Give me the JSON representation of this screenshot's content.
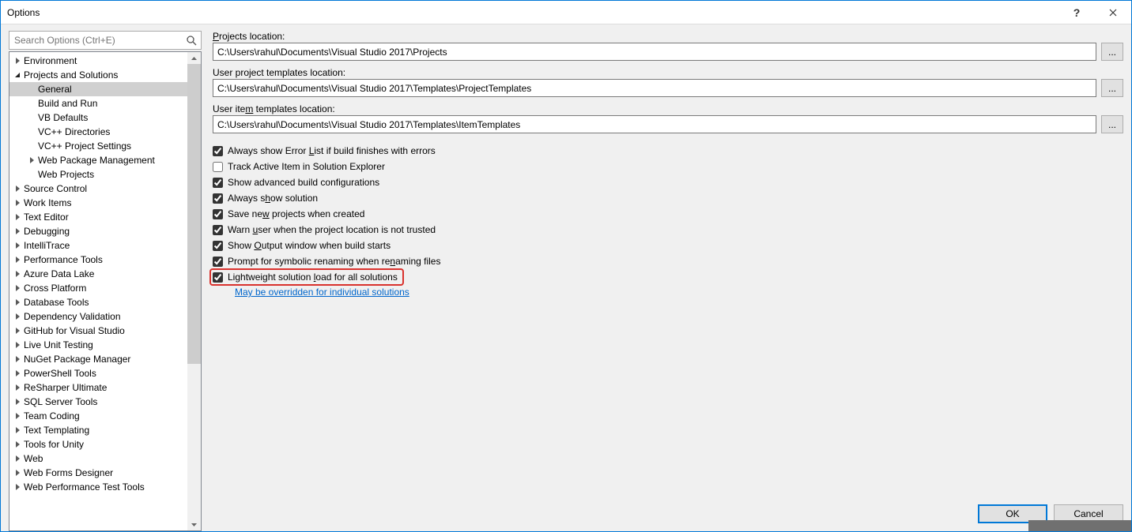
{
  "title": "Options",
  "search": {
    "placeholder": "Search Options (Ctrl+E)"
  },
  "tree": {
    "items": [
      {
        "label": "Environment",
        "indent": 0,
        "arrow": "closed"
      },
      {
        "label": "Projects and Solutions",
        "indent": 0,
        "arrow": "open"
      },
      {
        "label": "General",
        "indent": 1,
        "selected": true
      },
      {
        "label": "Build and Run",
        "indent": 1
      },
      {
        "label": "VB Defaults",
        "indent": 1
      },
      {
        "label": "VC++ Directories",
        "indent": 1
      },
      {
        "label": "VC++ Project Settings",
        "indent": 1
      },
      {
        "label": "Web Package Management",
        "indent": 1,
        "arrow": "closed"
      },
      {
        "label": "Web Projects",
        "indent": 1
      },
      {
        "label": "Source Control",
        "indent": 0,
        "arrow": "closed"
      },
      {
        "label": "Work Items",
        "indent": 0,
        "arrow": "closed"
      },
      {
        "label": "Text Editor",
        "indent": 0,
        "arrow": "closed"
      },
      {
        "label": "Debugging",
        "indent": 0,
        "arrow": "closed"
      },
      {
        "label": "IntelliTrace",
        "indent": 0,
        "arrow": "closed"
      },
      {
        "label": "Performance Tools",
        "indent": 0,
        "arrow": "closed"
      },
      {
        "label": "Azure Data Lake",
        "indent": 0,
        "arrow": "closed"
      },
      {
        "label": "Cross Platform",
        "indent": 0,
        "arrow": "closed"
      },
      {
        "label": "Database Tools",
        "indent": 0,
        "arrow": "closed"
      },
      {
        "label": "Dependency Validation",
        "indent": 0,
        "arrow": "closed"
      },
      {
        "label": "GitHub for Visual Studio",
        "indent": 0,
        "arrow": "closed"
      },
      {
        "label": "Live Unit Testing",
        "indent": 0,
        "arrow": "closed"
      },
      {
        "label": "NuGet Package Manager",
        "indent": 0,
        "arrow": "closed"
      },
      {
        "label": "PowerShell Tools",
        "indent": 0,
        "arrow": "closed"
      },
      {
        "label": "ReSharper Ultimate",
        "indent": 0,
        "arrow": "closed"
      },
      {
        "label": "SQL Server Tools",
        "indent": 0,
        "arrow": "closed"
      },
      {
        "label": "Team Coding",
        "indent": 0,
        "arrow": "closed"
      },
      {
        "label": "Text Templating",
        "indent": 0,
        "arrow": "closed"
      },
      {
        "label": "Tools for Unity",
        "indent": 0,
        "arrow": "closed"
      },
      {
        "label": "Web",
        "indent": 0,
        "arrow": "closed"
      },
      {
        "label": "Web Forms Designer",
        "indent": 0,
        "arrow": "closed"
      },
      {
        "label": "Web Performance Test Tools",
        "indent": 0,
        "arrow": "closed"
      }
    ]
  },
  "fields": {
    "projects_label_pre": "",
    "projects_label_ul": "P",
    "projects_label_post": "rojects location:",
    "projects_value": "C:\\Users\\rahul\\Documents\\Visual Studio 2017\\Projects",
    "userproj_label": "User project templates location:",
    "userproj_value": "C:\\Users\\rahul\\Documents\\Visual Studio 2017\\Templates\\ProjectTemplates",
    "useritem_label_pre": "User ite",
    "useritem_label_ul": "m",
    "useritem_label_post": " templates location:",
    "useritem_value": "C:\\Users\\rahul\\Documents\\Visual Studio 2017\\Templates\\ItemTemplates",
    "browse": "..."
  },
  "checks": {
    "c0": {
      "checked": true,
      "pre": "Always show Error ",
      "ul": "L",
      "post": "ist if build finishes with errors"
    },
    "c1": {
      "checked": false,
      "pre": "Track Active Item in Solution Explorer",
      "ul": "",
      "post": ""
    },
    "c2": {
      "checked": true,
      "pre": "Show advanced build configurations",
      "ul": "",
      "post": ""
    },
    "c3": {
      "checked": true,
      "pre": "Always s",
      "ul": "h",
      "post": "ow solution"
    },
    "c4": {
      "checked": true,
      "pre": "Save ne",
      "ul": "w",
      "post": " projects when created"
    },
    "c5": {
      "checked": true,
      "pre": "Warn ",
      "ul": "u",
      "post": "ser when the project location is not trusted"
    },
    "c6": {
      "checked": true,
      "pre": "Show ",
      "ul": "O",
      "post": "utput window when build starts"
    },
    "c7": {
      "checked": true,
      "pre": "Prompt for symbolic renaming when re",
      "ul": "n",
      "post": "aming files"
    },
    "c8": {
      "checked": true,
      "pre": "Lightweight solution ",
      "ul": "l",
      "post": "oad for all solutions"
    },
    "sublink": "May be overridden for individual solutions"
  },
  "buttons": {
    "ok": "OK",
    "cancel": "Cancel"
  }
}
